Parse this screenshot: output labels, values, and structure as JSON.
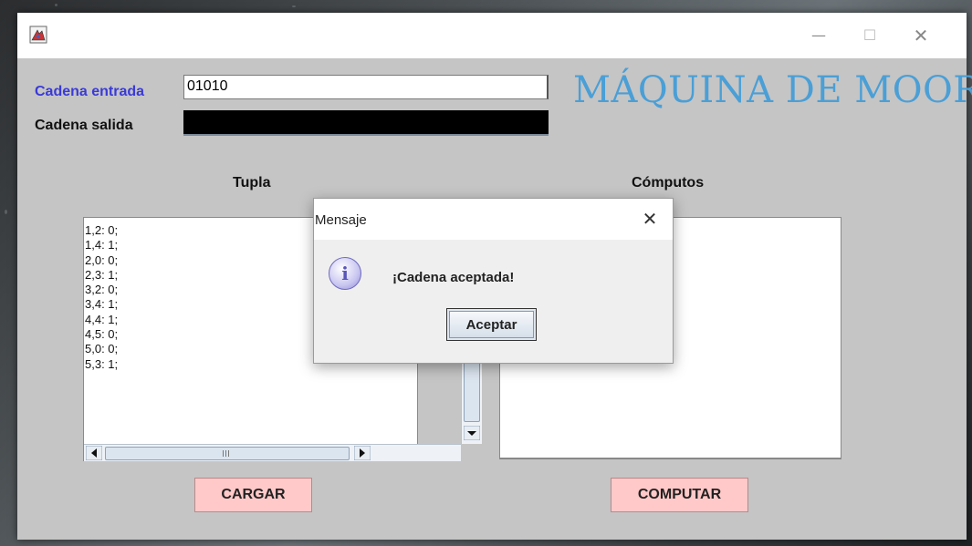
{
  "window": {
    "minimize_glyph": "—",
    "maximize_glyph": "☐",
    "close_glyph": "✕"
  },
  "form": {
    "input_label": "Cadena entrada",
    "input_value": "01010",
    "output_label": "Cadena salida",
    "output_value": "",
    "app_title": "MÁQUINA DE MOORE"
  },
  "tuplas": {
    "header": "Tupla",
    "lines": [
      "1,2: 0;",
      "1,4: 1;",
      "2,0: 0;",
      "2,3: 1;",
      "3,2: 0;",
      "3,4: 1;",
      "4,4: 1;",
      "4,5: 0;",
      "5,0: 0;",
      "5,3: 1;"
    ]
  },
  "computos": {
    "header": "Cómputos"
  },
  "buttons": {
    "load": "CARGAR",
    "compute": "COMPUTAR"
  },
  "dialog": {
    "title": "Mensaje",
    "message": "¡Cadena aceptada!",
    "ok_label": "Aceptar",
    "close_glyph": "✕"
  },
  "colors": {
    "input_label": "#3a3ad8",
    "app_title": "#4a9fd6",
    "button_bg": "#ffc9c9",
    "window_bg": "#c5c5c5"
  }
}
